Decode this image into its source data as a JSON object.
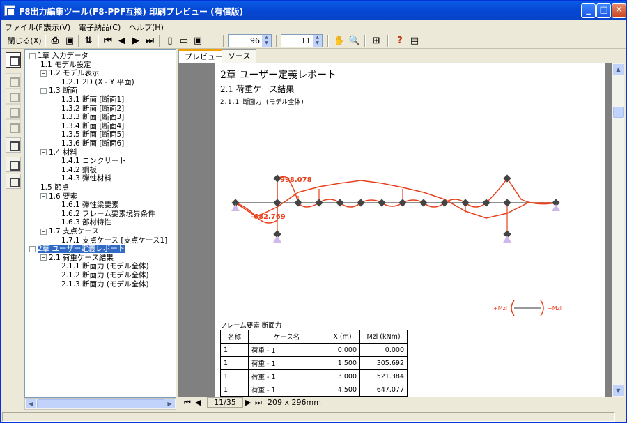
{
  "window": {
    "title": "F8出力編集ツール(F8-PPF互換) 印刷プレビュー (有償版)"
  },
  "menu": {
    "items": [
      "ファイル(F)",
      "表示(V)",
      "電子納品(C)",
      "ヘルプ(H)"
    ]
  },
  "toolbar": {
    "close_label": "閉じる(X)",
    "zoom_value": "96",
    "page_value": "11"
  },
  "tree": {
    "nodes": [
      {
        "label": "1章 入力データ",
        "level": 0,
        "exp": "−"
      },
      {
        "label": "1.1 モデル設定",
        "level": 1
      },
      {
        "label": "1.2 モデル表示",
        "level": 1,
        "exp": "−"
      },
      {
        "label": "1.2.1 2D (X - Y 平面)",
        "level": 2
      },
      {
        "label": "1.3 断面",
        "level": 1,
        "exp": "−"
      },
      {
        "label": "1.3.1 断面 [断面1]",
        "level": 2
      },
      {
        "label": "1.3.2 断面 [断面2]",
        "level": 2
      },
      {
        "label": "1.3.3 断面 [断面3]",
        "level": 2
      },
      {
        "label": "1.3.4 断面 [断面4]",
        "level": 2
      },
      {
        "label": "1.3.5 断面 [断面5]",
        "level": 2
      },
      {
        "label": "1.3.6 断面 [断面6]",
        "level": 2
      },
      {
        "label": "1.4 材料",
        "level": 1,
        "exp": "−"
      },
      {
        "label": "1.4.1 コンクリート",
        "level": 2
      },
      {
        "label": "1.4.2 鋼板",
        "level": 2
      },
      {
        "label": "1.4.3 弾性材料",
        "level": 2
      },
      {
        "label": "1.5 節点",
        "level": 1
      },
      {
        "label": "1.6 要素",
        "level": 1,
        "exp": "−"
      },
      {
        "label": "1.6.1 弾性梁要素",
        "level": 2
      },
      {
        "label": "1.6.2 フレーム要素境界条件",
        "level": 2
      },
      {
        "label": "1.6.3 部材特性",
        "level": 2
      },
      {
        "label": "1.7 支点ケース",
        "level": 1,
        "exp": "−"
      },
      {
        "label": "1.7.1 支点ケース [支点ケース1]",
        "level": 2
      },
      {
        "label": "2章 ユーザー定義レポート",
        "level": 0,
        "exp": "−",
        "selected": true
      },
      {
        "label": "2.1 荷重ケース結果",
        "level": 1,
        "exp": "−"
      },
      {
        "label": "2.1.1 断面力 (モデル全体)",
        "level": 2
      },
      {
        "label": "2.1.2 断面力 (モデル全体)",
        "level": 2
      },
      {
        "label": "2.1.3 断面力 (モデル全体)",
        "level": 2
      }
    ]
  },
  "tabs": [
    "プレビュー",
    "ソース"
  ],
  "document": {
    "chapter": "2章 ユーザー定義レポート",
    "section": "2.1 荷重ケース結果",
    "subsection": "2.1.1 断面力 (モデル全体)",
    "diagram_labels": {
      "max": "998.078",
      "min": "-682.769"
    },
    "legend_left": "+Mzl",
    "legend_right": "+Mzl",
    "table_title": "フレーム要素 断面力",
    "table": {
      "headers": [
        "名称",
        "ケース名",
        "X (m)",
        "Mzl (kNm)"
      ],
      "rows": [
        [
          "1",
          "荷重 - 1",
          "0.000",
          "0.000"
        ],
        [
          "1",
          "荷重 - 1",
          "1.500",
          "305.692"
        ],
        [
          "1",
          "荷重 - 1",
          "3.000",
          "521.384"
        ],
        [
          "1",
          "荷重 - 1",
          "4.500",
          "647.077"
        ]
      ]
    }
  },
  "pagenav": {
    "page": "11/35",
    "size": "209 x 296mm"
  },
  "colors": {
    "moment_line": "#e8401c",
    "frame": "#6b6b6b",
    "selection": "#316ac5",
    "titlebar": "#0547d4"
  }
}
